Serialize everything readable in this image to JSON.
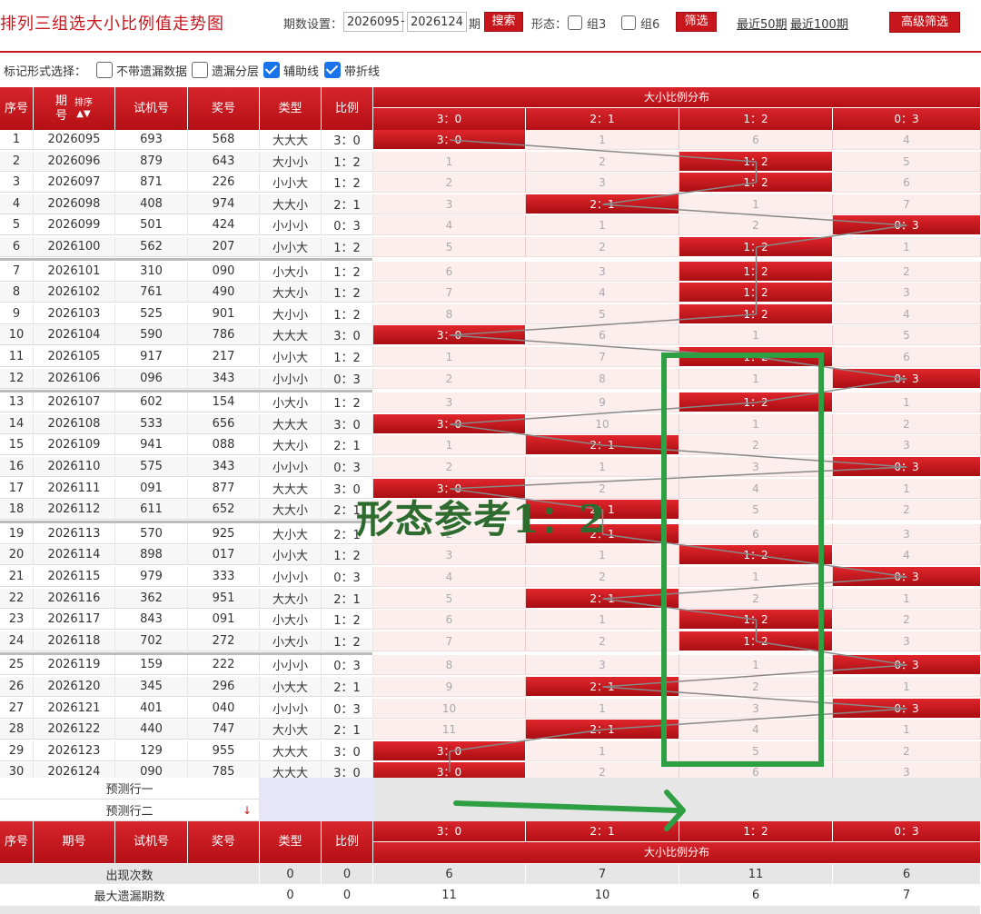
{
  "title": "排列三组选大小比例值走势图",
  "toolbar": {
    "period_label": "期数设置：",
    "start": "2026095",
    "dash": "-",
    "end": "2026124",
    "period_suffix": "期",
    "search": "搜索",
    "form_label": "形态：",
    "group3": "组3",
    "group6": "组6",
    "filter": "筛选",
    "recent50": "最近50期",
    "recent100": "最近100期",
    "advanced": "高级筛选"
  },
  "options": {
    "label": "标记形式选择：",
    "items": [
      {
        "label": "不带遗漏数据",
        "checked": false
      },
      {
        "label": "遗漏分层",
        "checked": false
      },
      {
        "label": "辅助线",
        "checked": true
      },
      {
        "label": "带折线",
        "checked": true
      }
    ]
  },
  "headers": {
    "seq": "序号",
    "period_top": "期",
    "period_bottom": "号",
    "sort": "排序",
    "sort_arrows": "▲▼",
    "test": "试机号",
    "prize": "奖号",
    "type": "类型",
    "ratio": "比例",
    "dist": "大小比例分布",
    "dist_cols": [
      "3：0",
      "2：1",
      "1：2",
      "0：3"
    ],
    "period": "期号"
  },
  "rows": [
    {
      "seq": "1",
      "period": "2026095",
      "test": "693",
      "prize": "568",
      "type": "大大大",
      "ratio": "3：0",
      "d": [
        "3：0",
        "1",
        "6",
        "4"
      ],
      "hit": 0
    },
    {
      "seq": "2",
      "period": "2026096",
      "test": "879",
      "prize": "643",
      "type": "大小小",
      "ratio": "1：2",
      "d": [
        "1",
        "2",
        "1：2",
        "5"
      ],
      "hit": 2
    },
    {
      "seq": "3",
      "period": "2026097",
      "test": "871",
      "prize": "226",
      "type": "小小大",
      "ratio": "1：2",
      "d": [
        "2",
        "3",
        "1：2",
        "6"
      ],
      "hit": 2
    },
    {
      "seq": "4",
      "period": "2026098",
      "test": "408",
      "prize": "974",
      "type": "大大小",
      "ratio": "2：1",
      "d": [
        "3",
        "2：1",
        "1",
        "7"
      ],
      "hit": 1
    },
    {
      "seq": "5",
      "period": "2026099",
      "test": "501",
      "prize": "424",
      "type": "小小小",
      "ratio": "0：3",
      "d": [
        "4",
        "1",
        "2",
        "0：3"
      ],
      "hit": 3
    },
    {
      "seq": "6",
      "period": "2026100",
      "test": "562",
      "prize": "207",
      "type": "小小大",
      "ratio": "1：2",
      "d": [
        "5",
        "2",
        "1：2",
        "1"
      ],
      "hit": 2
    },
    {
      "seq": "7",
      "period": "2026101",
      "test": "310",
      "prize": "090",
      "type": "小大小",
      "ratio": "1：2",
      "d": [
        "6",
        "3",
        "1：2",
        "2"
      ],
      "hit": 2
    },
    {
      "seq": "8",
      "period": "2026102",
      "test": "761",
      "prize": "490",
      "type": "大大小",
      "ratio": "1：2",
      "d": [
        "7",
        "4",
        "1：2",
        "3"
      ],
      "hit": 2
    },
    {
      "seq": "9",
      "period": "2026103",
      "test": "525",
      "prize": "901",
      "type": "大小小",
      "ratio": "1：2",
      "d": [
        "8",
        "5",
        "1：2",
        "4"
      ],
      "hit": 2
    },
    {
      "seq": "10",
      "period": "2026104",
      "test": "590",
      "prize": "786",
      "type": "大大大",
      "ratio": "3：0",
      "d": [
        "3：0",
        "6",
        "1",
        "5"
      ],
      "hit": 0
    },
    {
      "seq": "11",
      "period": "2026105",
      "test": "917",
      "prize": "217",
      "type": "小小大",
      "ratio": "1：2",
      "d": [
        "1",
        "7",
        "1：2",
        "6"
      ],
      "hit": 2
    },
    {
      "seq": "12",
      "period": "2026106",
      "test": "096",
      "prize": "343",
      "type": "小小小",
      "ratio": "0：3",
      "d": [
        "2",
        "8",
        "1",
        "0：3"
      ],
      "hit": 3
    },
    {
      "seq": "13",
      "period": "2026107",
      "test": "602",
      "prize": "154",
      "type": "小大小",
      "ratio": "1：2",
      "d": [
        "3",
        "9",
        "1：2",
        "1"
      ],
      "hit": 2
    },
    {
      "seq": "14",
      "period": "2026108",
      "test": "533",
      "prize": "656",
      "type": "大大大",
      "ratio": "3：0",
      "d": [
        "3：0",
        "10",
        "1",
        "2"
      ],
      "hit": 0
    },
    {
      "seq": "15",
      "period": "2026109",
      "test": "941",
      "prize": "088",
      "type": "大大小",
      "ratio": "2：1",
      "d": [
        "1",
        "2：1",
        "2",
        "3"
      ],
      "hit": 1
    },
    {
      "seq": "16",
      "period": "2026110",
      "test": "575",
      "prize": "343",
      "type": "小小小",
      "ratio": "0：3",
      "d": [
        "2",
        "1",
        "3",
        "0：3"
      ],
      "hit": 3
    },
    {
      "seq": "17",
      "period": "2026111",
      "test": "091",
      "prize": "877",
      "type": "大大大",
      "ratio": "3：0",
      "d": [
        "3：0",
        "2",
        "4",
        "1"
      ],
      "hit": 0
    },
    {
      "seq": "18",
      "period": "2026112",
      "test": "611",
      "prize": "652",
      "type": "大大小",
      "ratio": "2：1",
      "d": [
        "1",
        "2：1",
        "5",
        "2"
      ],
      "hit": 1
    },
    {
      "seq": "19",
      "period": "2026113",
      "test": "570",
      "prize": "925",
      "type": "大小大",
      "ratio": "2：1",
      "d": [
        "2",
        "2：1",
        "6",
        "3"
      ],
      "hit": 1
    },
    {
      "seq": "20",
      "period": "2026114",
      "test": "898",
      "prize": "017",
      "type": "小小大",
      "ratio": "1：2",
      "d": [
        "3",
        "1",
        "1：2",
        "4"
      ],
      "hit": 2
    },
    {
      "seq": "21",
      "period": "2026115",
      "test": "979",
      "prize": "333",
      "type": "小小小",
      "ratio": "0：3",
      "d": [
        "4",
        "2",
        "1",
        "0：3"
      ],
      "hit": 3
    },
    {
      "seq": "22",
      "period": "2026116",
      "test": "362",
      "prize": "951",
      "type": "大大小",
      "ratio": "2：1",
      "d": [
        "5",
        "2：1",
        "2",
        "1"
      ],
      "hit": 1
    },
    {
      "seq": "23",
      "period": "2026117",
      "test": "843",
      "prize": "091",
      "type": "小大小",
      "ratio": "1：2",
      "d": [
        "6",
        "1",
        "1：2",
        "2"
      ],
      "hit": 2
    },
    {
      "seq": "24",
      "period": "2026118",
      "test": "702",
      "prize": "272",
      "type": "小大小",
      "ratio": "1：2",
      "d": [
        "7",
        "2",
        "1：2",
        "3"
      ],
      "hit": 2
    },
    {
      "seq": "25",
      "period": "2026119",
      "test": "159",
      "prize": "222",
      "type": "小小小",
      "ratio": "0：3",
      "d": [
        "8",
        "3",
        "1",
        "0：3"
      ],
      "hit": 3
    },
    {
      "seq": "26",
      "period": "2026120",
      "test": "345",
      "prize": "296",
      "type": "小大大",
      "ratio": "2：1",
      "d": [
        "9",
        "2：1",
        "2",
        "1"
      ],
      "hit": 1
    },
    {
      "seq": "27",
      "period": "2026121",
      "test": "401",
      "prize": "040",
      "type": "小小小",
      "ratio": "0：3",
      "d": [
        "10",
        "1",
        "3",
        "0：3"
      ],
      "hit": 3
    },
    {
      "seq": "28",
      "period": "2026122",
      "test": "440",
      "prize": "747",
      "type": "大小大",
      "ratio": "2：1",
      "d": [
        "11",
        "2：1",
        "4",
        "1"
      ],
      "hit": 1
    },
    {
      "seq": "29",
      "period": "2026123",
      "test": "129",
      "prize": "955",
      "type": "大大大",
      "ratio": "3：0",
      "d": [
        "3：0",
        "1",
        "5",
        "2"
      ],
      "hit": 0
    },
    {
      "seq": "30",
      "period": "2026124",
      "test": "090",
      "prize": "785",
      "type": "大大大",
      "ratio": "3：0",
      "d": [
        "3：0",
        "2",
        "6",
        "3"
      ],
      "hit": 0
    }
  ],
  "predict": {
    "row1": "预测行一",
    "row2": "预测行二",
    "arrow": "↓"
  },
  "stats": [
    {
      "label": "出现次数",
      "type": "0",
      "ratio": "0",
      "d": [
        "6",
        "7",
        "11",
        "6"
      ]
    },
    {
      "label": "最大遗漏期数",
      "type": "0",
      "ratio": "0",
      "d": [
        "11",
        "10",
        "6",
        "7"
      ]
    }
  ],
  "annotation": {
    "text": "形态参考1：2",
    "color": "#2ea043"
  },
  "colors": {
    "red": "#c8161d",
    "pink": "#fdeeee",
    "green": "#2ea043"
  }
}
